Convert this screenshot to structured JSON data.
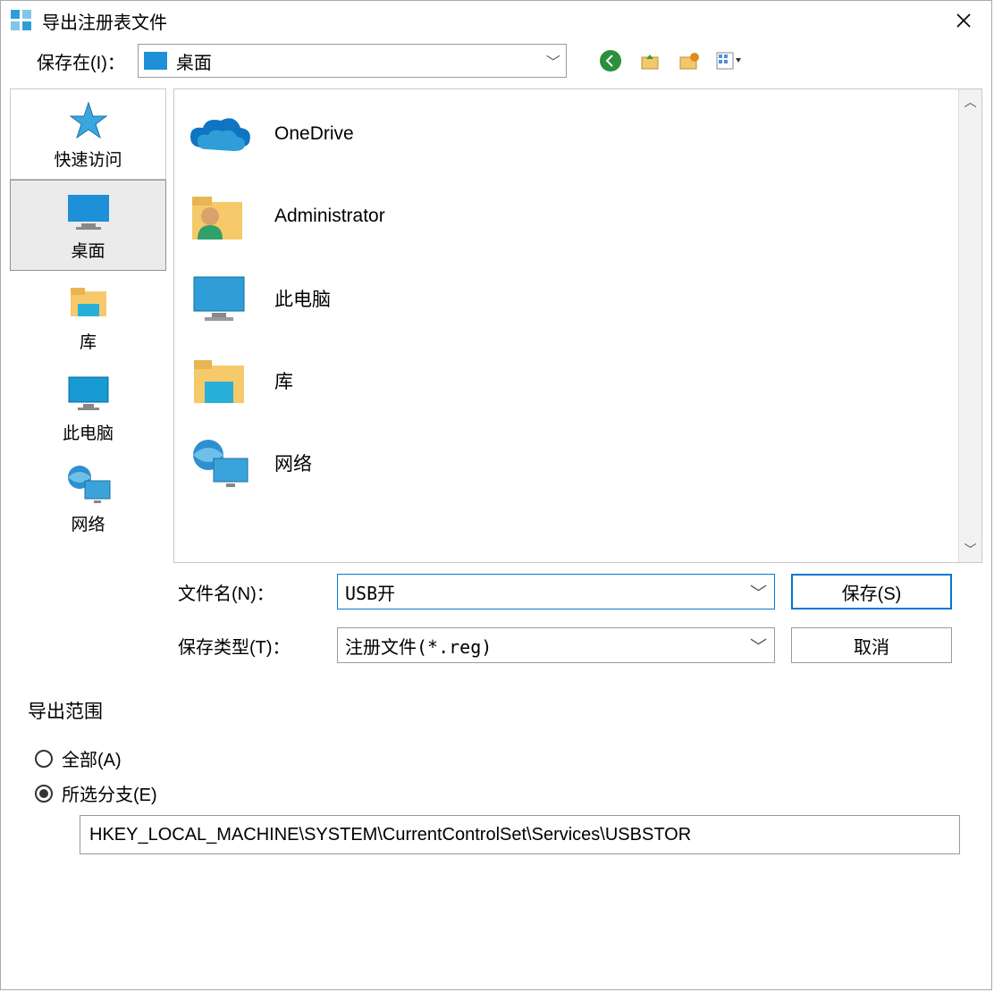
{
  "window": {
    "title": "导出注册表文件"
  },
  "top": {
    "save_in_label": "保存在(I)：",
    "save_in_value": "桌面"
  },
  "places": [
    {
      "label": "快速访问"
    },
    {
      "label": "桌面"
    },
    {
      "label": "库"
    },
    {
      "label": "此电脑"
    },
    {
      "label": "网络"
    }
  ],
  "items": [
    {
      "name": "OneDrive"
    },
    {
      "name": "Administrator"
    },
    {
      "name": "此电脑"
    },
    {
      "name": "库"
    },
    {
      "name": "网络"
    }
  ],
  "fields": {
    "filename_label": "文件名(N)：",
    "filename_value": "USB开",
    "type_label": "保存类型(T)：",
    "type_value": "注册文件(*.reg)"
  },
  "buttons": {
    "save": "保存(S)",
    "cancel": "取消"
  },
  "group": {
    "legend": "导出范围",
    "opt_all": "全部(A)",
    "opt_branch": "所选分支(E)",
    "branch_path": "HKEY_LOCAL_MACHINE\\SYSTEM\\CurrentControlSet\\Services\\USBSTOR"
  }
}
